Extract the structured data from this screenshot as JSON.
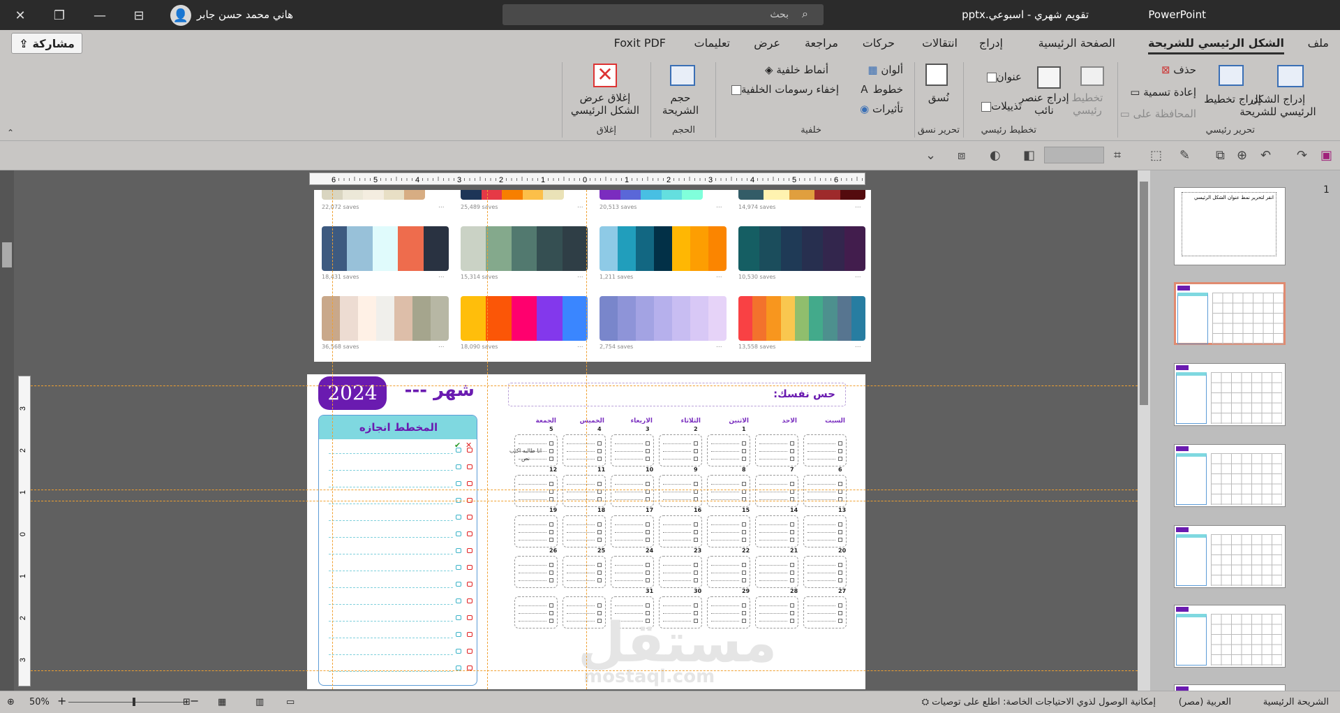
{
  "titlebar": {
    "doc_title": "تقويم شهري - اسبوعي.pptx",
    "app_name": "PowerPoint",
    "user_name": "هاني محمد حسن جابر",
    "search_placeholder": "بحث"
  },
  "menubar": {
    "tabs": [
      "ملف",
      "الشكل الرئيسي للشريحة",
      "الصفحة الرئيسية",
      "إدراج",
      "انتقالات",
      "حركات",
      "مراجعة",
      "عرض",
      "تعليمات",
      "Foxit PDF"
    ],
    "share_label": "مشاركة"
  },
  "ribbon": {
    "insert_master": "إدراج الشكل الرئيسي للشريحة",
    "insert_layout": "إدراج تخطيط",
    "delete": "حذف",
    "rename": "إعادة تسمية",
    "preserve": "المحافظة على",
    "group_edit_master": "تحرير رئيسي",
    "master_layout": "تخطيط رئيسي",
    "insert_placeholder": "إدراج عنصر نائب",
    "title_chk": "عنوان",
    "footers_chk": "تذييلات",
    "group_master_layout": "تخطيط رئيسي",
    "theme": "نُسق",
    "group_edit_theme": "تحرير نسق",
    "colors": "ألوان",
    "fonts": "خطوط",
    "effects": "تأثيرات",
    "bg_styles": "أنماط خلفية",
    "hide_bg": "إخفاء رسومات الخلفية",
    "group_background": "خلفية",
    "slide_size": "حجم الشريحة",
    "group_size": "الحجم",
    "close_master": "إغلاق عرض الشكل الرئيسي",
    "group_close": "إغلاق"
  },
  "palettes": {
    "row1_saves": [
      "22,072 saves",
      "25,489 saves",
      "20,513 saves",
      "14,974 saves"
    ],
    "row2_saves": [
      "18,431 saves",
      "15,314 saves",
      "1,211 saves",
      "10,530 saves"
    ],
    "row3_saves": [
      "36,568 saves",
      "18,090 saves",
      "2,754 saves",
      "13,558 saves"
    ],
    "more": "..."
  },
  "ruler": {
    "h_ticks": [
      "6",
      "5",
      "4",
      "3",
      "2",
      "1",
      "0",
      "1",
      "2",
      "3",
      "4",
      "5",
      "6"
    ],
    "v_ticks": [
      "3",
      "2",
      "1",
      "0",
      "1",
      "2",
      "3"
    ]
  },
  "calendar": {
    "month_word": "شهر ---",
    "year": "2024",
    "note": "حس نفسك:",
    "todo_title": "المخطط انجازه",
    "day_names": [
      "السبت",
      "الاحد",
      "الاثنين",
      "الثلاثاء",
      "الاربعاء",
      "الخميس",
      "الجمعة"
    ],
    "weeks": [
      [
        "",
        "",
        "1",
        "2",
        "3",
        "4",
        "5"
      ],
      [
        "6",
        "7",
        "8",
        "9",
        "10",
        "11",
        "12"
      ],
      [
        "13",
        "14",
        "15",
        "16",
        "17",
        "18",
        "19"
      ],
      [
        "20",
        "21",
        "22",
        "23",
        "24",
        "25",
        "26"
      ],
      [
        "27",
        "28",
        "29",
        "30",
        "31",
        "",
        ""
      ]
    ],
    "cell_note": "انا طالبه اكتب نص"
  },
  "watermark": {
    "ar": "مستقل",
    "en": "mostaql.com"
  },
  "thumbnails": {
    "first_number": "1",
    "first_title": "انقر لتحرير نمط عنوان الشكل الرئيسي"
  },
  "statusbar": {
    "view": "الشريحة الرئيسية",
    "lang": "العربية (مصر)",
    "accessibility": "إمكانية الوصول لذوي الاحتياجات الخاصة: اطلع على توصيات",
    "zoom": "50%"
  }
}
